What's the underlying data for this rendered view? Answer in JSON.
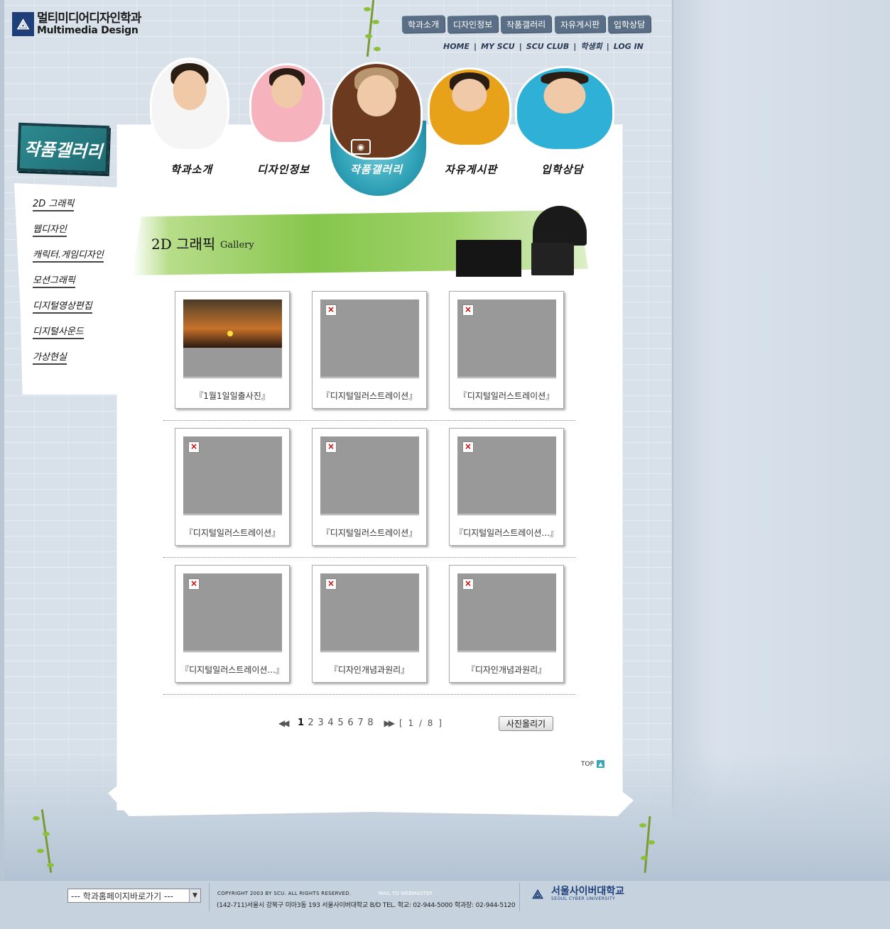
{
  "logo": {
    "mark": "⟁",
    "korean": "멀티미디어디자인학과",
    "english": "Multimedia Design"
  },
  "top_nav": [
    "학과소개",
    "디자인정보",
    "작품갤러리",
    "자유게시판",
    "입학상담"
  ],
  "sub_nav": [
    "HOME",
    "MY SCU",
    "SCU CLUB",
    "학생회",
    "LOG IN"
  ],
  "sub_nav_separator": "|",
  "persons": [
    {
      "label": "학과소개",
      "shirt": "#f5f5f5"
    },
    {
      "label": "디자인정보",
      "shirt": "#f7b3bd"
    },
    {
      "label": "작품갤러리",
      "shirt": "#6b3a1f"
    },
    {
      "label": "자유게시판",
      "shirt": "#e8a21a"
    },
    {
      "label": "입학상담",
      "shirt": "#2fb0d6"
    }
  ],
  "left_menu": {
    "title": "작품갤러리",
    "items": [
      "2D 그래픽",
      "웹디자인",
      "캐릭터.게임디자인",
      "모션그래픽",
      "디지털영상편집",
      "디지털사운드",
      "가상현실"
    ]
  },
  "banner": {
    "title": "2D 그래픽",
    "subtitle": "Gallery"
  },
  "gallery": [
    {
      "caption": "『1월1일일출사진』",
      "image": "sunset"
    },
    {
      "caption": "『디지털일러스트레이션』",
      "image": "broken"
    },
    {
      "caption": "『디지털일러스트레이션』",
      "image": "broken"
    },
    {
      "caption": "『디지털일러스트레이션』",
      "image": "broken"
    },
    {
      "caption": "『디지털일러스트레이션』",
      "image": "broken"
    },
    {
      "caption": "『디지털일러스트레이션...』",
      "image": "broken"
    },
    {
      "caption": "『디지털일러스트레이션...』",
      "image": "broken"
    },
    {
      "caption": "『디자인개념과원리』",
      "image": "broken"
    },
    {
      "caption": "『디자인개념과원리』",
      "image": "broken"
    }
  ],
  "pagination": {
    "first_icon": "◀◀",
    "last_icon": "▶▶",
    "pages": [
      "1",
      "2",
      "3",
      "4",
      "5",
      "6",
      "7",
      "8"
    ],
    "current": "1",
    "info": "[ 1 / 8 ]"
  },
  "upload_button": "사진올리기",
  "top_link": {
    "label": "TOP",
    "icon": "▲"
  },
  "footer": {
    "select_value": "--- 학과홈페이지바로가기 ---",
    "select_arrow": "▼",
    "copyright": "COPYRIGHT 2003 BY SCU. ALL RIGHTS RESERVED.",
    "mail": "MAIL TO WEBMASTER",
    "address": "(142-711)서울시 강북구 미아3동 193 서울사이버대학교 B/D   TEL. 학교: 02-944-5000   학과장: 02-944-5120",
    "university_mark": "⟁",
    "university_korean": "서울사이버대학교",
    "university_english": "SEOUL CYBER UNIVERSITY"
  },
  "colors": {
    "accent_teal": "#2c8a90",
    "navy": "#1e3f7a",
    "banner_green": "#86c64c"
  }
}
